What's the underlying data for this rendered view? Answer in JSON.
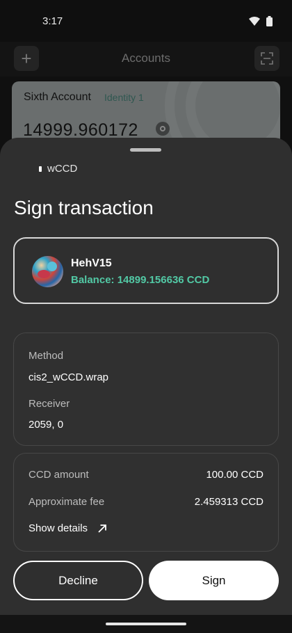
{
  "status_bar": {
    "time": "3:17"
  },
  "header": {
    "title": "Accounts",
    "add_icon": "plus-icon",
    "scan_icon": "scan-icon"
  },
  "account_card": {
    "name": "Sixth Account",
    "identity": "Identity 1",
    "balance": "14999.960172"
  },
  "sheet": {
    "dapp_name": "wCCD",
    "title": "Sign transaction",
    "selected_account": {
      "name": "HehV15",
      "balance": "Balance: 14899.156636 CCD"
    },
    "method_label": "Method",
    "method_value": "cis2_wCCD.wrap",
    "receiver_label": "Receiver",
    "receiver_value": "2059, 0",
    "ccd_amount_label": "CCD amount",
    "ccd_amount_value": "100.00 CCD",
    "fee_label": "Approximate fee",
    "fee_value": "2.459313 CCD",
    "details_label": "Show details",
    "decline_label": "Decline",
    "sign_label": "Sign"
  },
  "colors": {
    "sheet_bg": "#2f2f2f",
    "accent_green": "#52c9a5",
    "card_bg": "#6a6e6e"
  }
}
